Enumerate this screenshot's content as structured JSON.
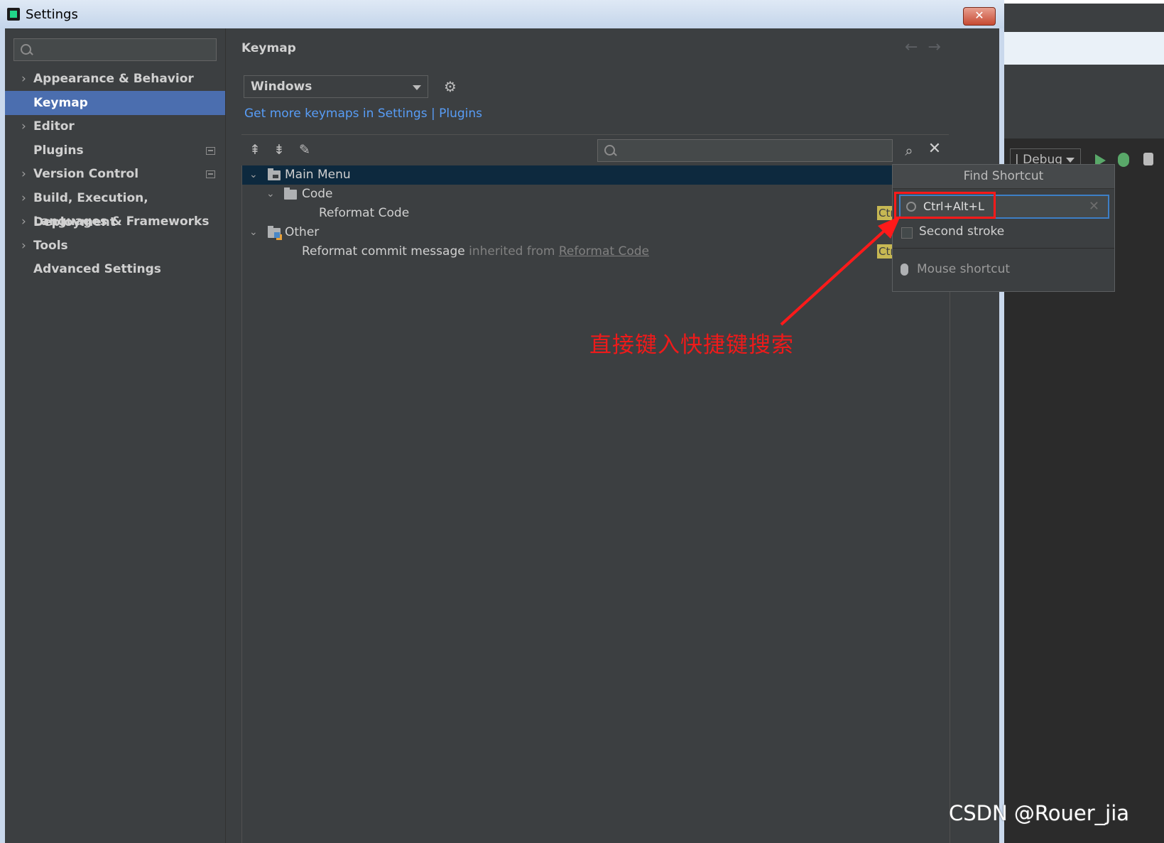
{
  "window": {
    "title": "Settings",
    "close_label": "✕"
  },
  "background_ide": {
    "config_label": "| Debug"
  },
  "sidebar": {
    "search_placeholder": "",
    "items": [
      {
        "label": "Appearance & Behavior",
        "expandable": true,
        "selected": false
      },
      {
        "label": "Keymap",
        "expandable": false,
        "selected": true
      },
      {
        "label": "Editor",
        "expandable": true,
        "selected": false
      },
      {
        "label": "Plugins",
        "expandable": false,
        "selected": false
      },
      {
        "label": "Version Control",
        "expandable": true,
        "selected": false
      },
      {
        "label": "Build, Execution, Deployment",
        "expandable": true,
        "selected": false
      },
      {
        "label": "Languages & Frameworks",
        "expandable": true,
        "selected": false
      },
      {
        "label": "Tools",
        "expandable": true,
        "selected": false
      },
      {
        "label": "Advanced Settings",
        "expandable": false,
        "selected": false
      }
    ]
  },
  "main": {
    "title": "Keymap",
    "keymap_selected": "Windows",
    "get_more_link": "Get more keymaps in Settings | Plugins",
    "tree": [
      {
        "label": "Main Menu"
      },
      {
        "label": "Code"
      },
      {
        "label": "Reformat Code",
        "shortcut": "Ctrl"
      },
      {
        "label": "Other"
      },
      {
        "label": "Reformat commit message",
        "suffix": "inherited from",
        "link": "Reformat Code",
        "shortcut": "Ctrl"
      }
    ]
  },
  "find_shortcut": {
    "title": "Find Shortcut",
    "value": "Ctrl+Alt+L",
    "second_stroke_label": "Second stroke",
    "second_stroke_checked": false,
    "mouse_shortcut_label": "Mouse shortcut"
  },
  "annotation": {
    "text": "直接键入快捷键搜索",
    "color": "#ef1a1a"
  },
  "watermark": "CSDN @Rouer_jia",
  "colors": {
    "selection": "#4b6eaf",
    "link": "#589df6",
    "tree_selection": "#0d293e",
    "shortcut_badge": "#c7b853",
    "focus_border": "#3d7fc6"
  }
}
